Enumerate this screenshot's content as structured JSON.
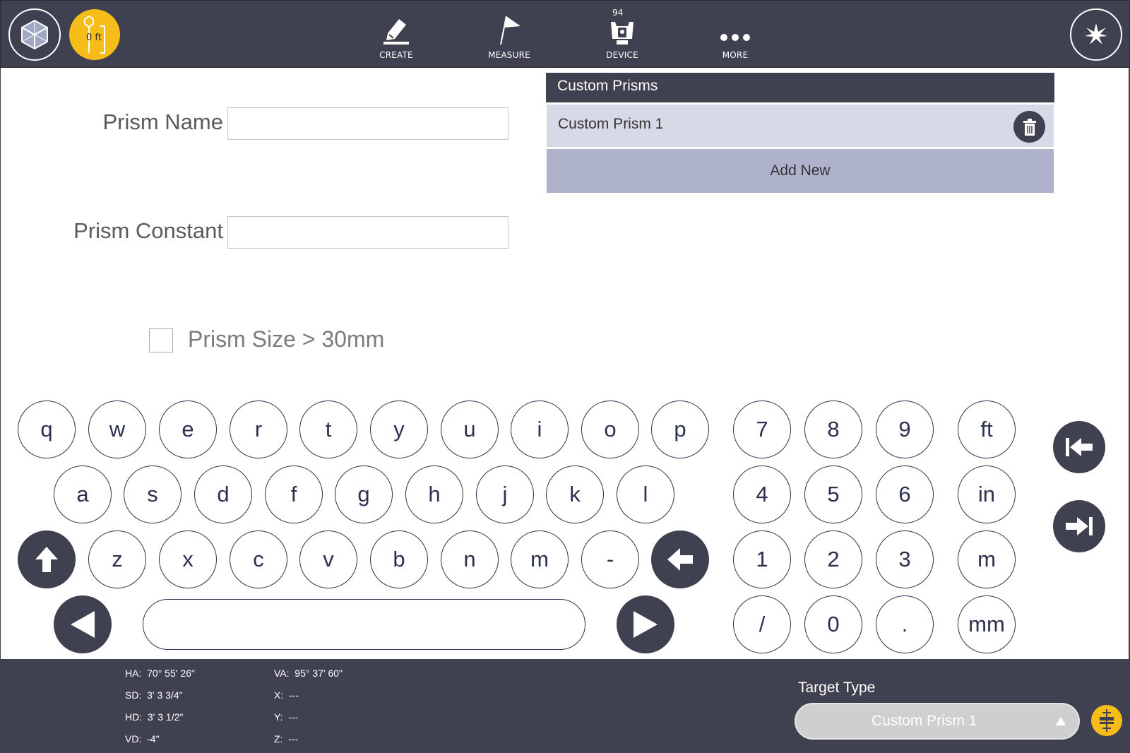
{
  "topbar": {
    "height_value": "0 ft",
    "nav": [
      {
        "label": "CREATE",
        "icon": "pencil-icon"
      },
      {
        "label": "MEASURE",
        "icon": "flag-icon"
      },
      {
        "label": "DEVICE",
        "icon": "total-station-icon"
      },
      {
        "label": "MORE",
        "icon": "more-dots-icon"
      }
    ],
    "battery": "94"
  },
  "form": {
    "prism_name_label": "Prism Name",
    "prism_name_value": "",
    "prism_constant_label": "Prism Constant",
    "prism_constant_value": "",
    "size_checkbox_label": "Prism Size > 30mm",
    "size_checked": false
  },
  "custom_prisms": {
    "header": "Custom Prisms",
    "items": [
      "Custom Prism 1"
    ],
    "add_label": "Add New"
  },
  "keyboard": {
    "row1": [
      "q",
      "w",
      "e",
      "r",
      "t",
      "y",
      "u",
      "i",
      "o",
      "p"
    ],
    "row2": [
      "a",
      "s",
      "d",
      "f",
      "g",
      "h",
      "j",
      "k",
      "l"
    ],
    "row3": [
      "z",
      "x",
      "c",
      "v",
      "b",
      "n",
      "m",
      "-"
    ],
    "numpad": [
      "7",
      "8",
      "9",
      "4",
      "5",
      "6",
      "1",
      "2",
      "3",
      "/",
      "0",
      "."
    ],
    "units": [
      "ft",
      "in",
      "m",
      "mm"
    ]
  },
  "measurements": {
    "ha": "HA:  70° 55' 26\"",
    "sd": "SD:  3' 3 3/4\"",
    "hd": "HD:  3' 3 1/2\"",
    "vd": "VD:  -4\"",
    "va": "VA:  95° 37' 60\"",
    "x": "X:  ---",
    "y": "Y:  ---",
    "z": "Z:  ---"
  },
  "target": {
    "label": "Target Type",
    "value": "Custom Prism 1"
  },
  "colors": {
    "bar": "#3f4150",
    "accent": "#f6bc18",
    "row": "#d7dae6",
    "add": "#aeb2cb"
  }
}
